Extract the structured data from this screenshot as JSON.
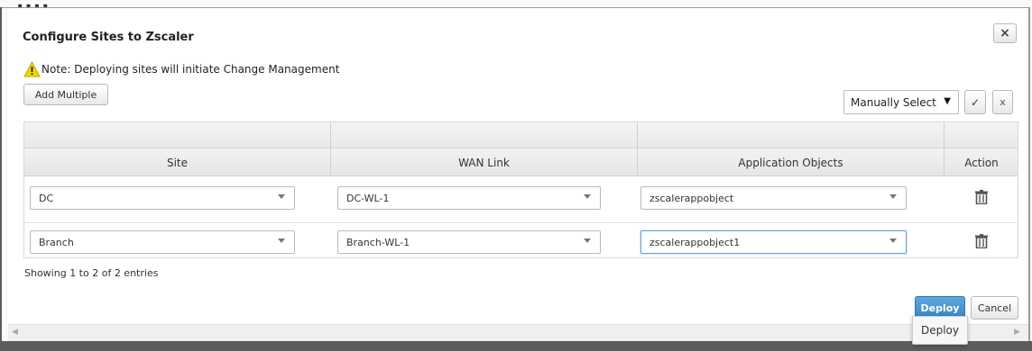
{
  "behind": {
    "title": "...."
  },
  "dialog": {
    "title": "Configure Sites to Zscaler",
    "close_label": "×",
    "note": "Note: Deploying sites will initiate Change Management",
    "add_multiple_label": "Add Multiple",
    "selection_mode": {
      "selected": "Manually Select",
      "caret": "▼"
    },
    "confirm_label": "✓",
    "discard_label": "x"
  },
  "table": {
    "columns": [
      "Site",
      "WAN Link",
      "Application Objects",
      "Action"
    ],
    "rows": [
      {
        "site": "DC",
        "wan_link": "DC-WL-1",
        "app_object": "zscalerappobject"
      },
      {
        "site": "Branch",
        "wan_link": "Branch-WL-1",
        "app_object": "zscalerappobject1"
      }
    ],
    "entries_text": "Showing 1 to 2 of 2 entries"
  },
  "footer": {
    "deploy_label": "Deploy",
    "cancel_label": "Cancel"
  },
  "scrollbar": {
    "left_arrow": "◀",
    "right_arrow": "▶"
  },
  "tooltip": {
    "text": "Deploy"
  },
  "colors": {
    "primary_button": "#3686c4",
    "warning_icon": "#f2d500",
    "active_field_border": "#6b9ed8"
  }
}
